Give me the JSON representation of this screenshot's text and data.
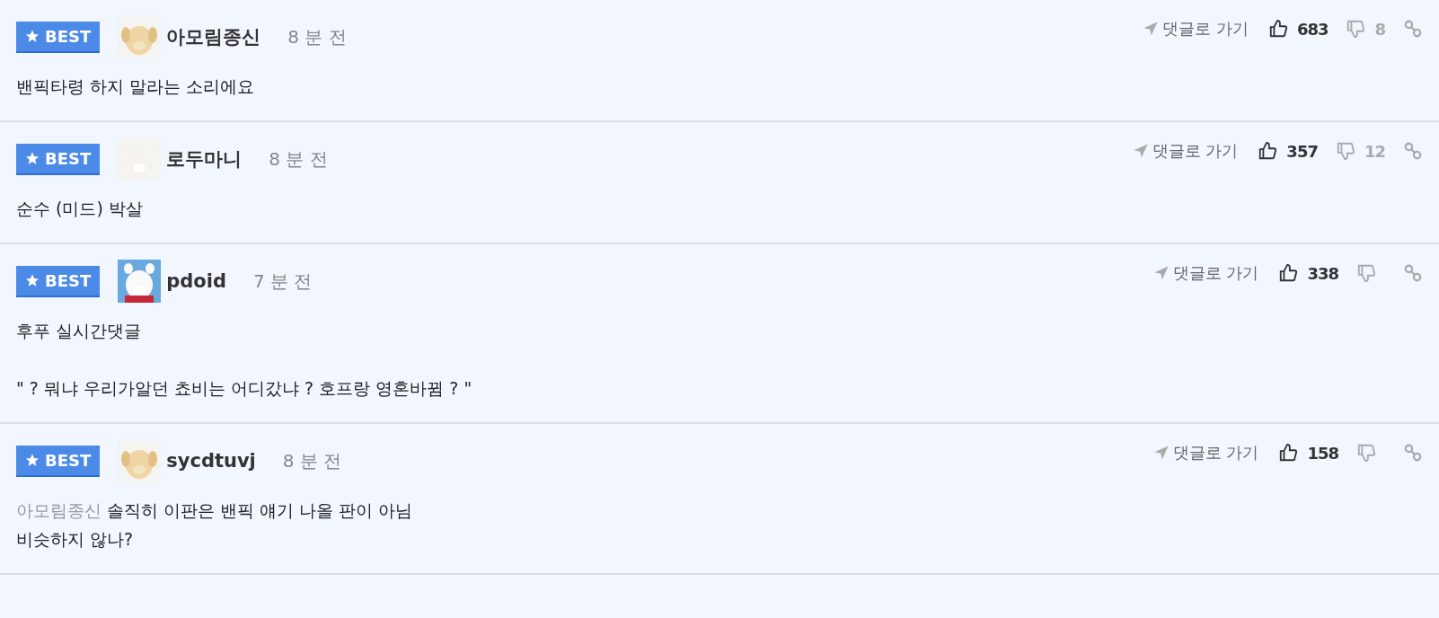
{
  "comments": [
    {
      "badge": "BEST",
      "avatar": {
        "kind": "picture"
      },
      "author": "아모림종신",
      "time": "8 분 전",
      "reply_link": "댓글로 가기",
      "likes": "683",
      "dislikes": "8",
      "paragraphs": [
        {
          "lines": [
            "밴픽타령 하지 말라는 소리에요"
          ]
        }
      ]
    },
    {
      "badge": "BEST",
      "avatar": {
        "kind": "picture"
      },
      "author": "로두마니",
      "time": "8 분 전",
      "reply_link": "댓글로 가기",
      "likes": "357",
      "dislikes": "12",
      "paragraphs": [
        {
          "lines": [
            "순수 (미드) 박살"
          ]
        }
      ]
    },
    {
      "badge": "BEST",
      "avatar": {
        "kind": "picture"
      },
      "author": "pdoid",
      "time": "7 분 전",
      "reply_link": "댓글로 가기",
      "likes": "338",
      "paragraphs": [
        {
          "lines": [
            "후푸 실시간댓글"
          ]
        },
        {
          "lines": [
            "\" ? 뭐냐 우리가알던 쵸비는 어디갔냐 ? 호프랑 영혼바뀜 ? \""
          ]
        }
      ]
    },
    {
      "badge": "BEST",
      "avatar": {
        "kind": "picture"
      },
      "author": "sycdtuvj",
      "time": "8 분 전",
      "reply_link": "댓글로 가기",
      "likes": "158",
      "paragraphs": [
        {
          "mention": "아모림종신",
          "lines": [
            "솔직히 이판은 밴픽 얘기 나올 판이 아님",
            "비슷하지 않나?"
          ]
        }
      ]
    }
  ]
}
